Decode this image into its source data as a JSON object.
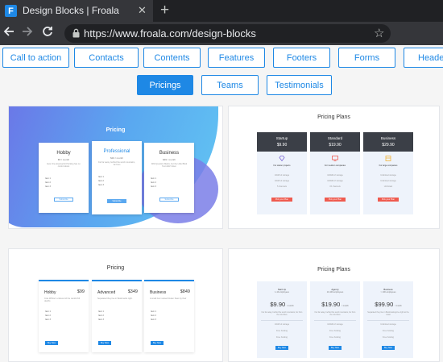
{
  "browser": {
    "tab_title": "Design Blocks | Froala",
    "favicon_letter": "F",
    "new_tab": "+",
    "close_tab": "✕",
    "url": "https://www.froala.com/design-blocks"
  },
  "categories": [
    "Call to action",
    "Contacts",
    "Contents",
    "Features",
    "Footers",
    "Forms",
    "Headers",
    "Pricings",
    "Teams",
    "Testimonials"
  ],
  "active_category": "Pricings",
  "cards": {
    "c1": {
      "title": "Pricing",
      "plans": [
        {
          "name": "Hobby",
          "price": "$5 / month",
          "desc": "Even the all-powerful Pointing has no control about",
          "items": [
            "Item 1",
            "Item 2",
            "Item 3"
          ],
          "button": "Subscribe"
        },
        {
          "name": "Professional",
          "price": "$19 / month",
          "desc": "Far far away, behind the word mountains, far from",
          "items": [
            "Item 1",
            "Item 2",
            "Item 3"
          ],
          "button": "Subscribe"
        },
        {
          "name": "Business",
          "price": "$49 / month",
          "desc": "Wild Question Marks, but the Little Blind Text didn't listen",
          "items": [
            "Item 1",
            "Item 2",
            "Item 3"
          ],
          "button": "Subscribe"
        }
      ]
    },
    "c2": {
      "title": "Pricing Plans",
      "plans": [
        {
          "name": "Startup",
          "price": "$9.90",
          "tag": "For starter projects",
          "lines": [
            "10GB of storage",
            "10GB of storage",
            "5 channels"
          ],
          "button": "Pick your Plan",
          "icon_color": "#7e6bd6"
        },
        {
          "name": "Standard",
          "price": "$19.90",
          "tag": "For medium companies",
          "lines": [
            "100GB of storage",
            "100GB of storage",
            "15 channels"
          ],
          "button": "Pick your Plan",
          "icon_color": "#ef5b4f"
        },
        {
          "name": "Business",
          "price": "$29.90",
          "tag": "For large companies",
          "lines": [
            "Unlimited storage",
            "Unlimited storage",
            "Unlimited"
          ],
          "button": "Pick your Plan",
          "icon_color": "#f2b43a"
        }
      ]
    },
    "c3": {
      "title": "Pricing",
      "plans": [
        {
          "name": "Hobby",
          "price": "$99",
          "desc": "Cras Whitre's unboxed of the candid hill depths",
          "items": [
            "Item 1",
            "Item 2",
            "Item 3"
          ],
          "button": "Buy Now"
        },
        {
          "name": "Advanced",
          "price": "$349",
          "desc": "Separated they live in Bookmarks right.",
          "items": [
            "Item 1",
            "Item 2",
            "Item 3"
          ],
          "button": "Buy Now"
        },
        {
          "name": "Business",
          "price": "$849",
          "desc": "A small river named Duden flows by their",
          "items": [
            "Item 1",
            "Item 2",
            "Item 3"
          ],
          "button": "Buy Now"
        }
      ]
    },
    "c4": {
      "title": "Pricing Plans",
      "plans": [
        {
          "name": "Start Up",
          "sub": "1-10 employees",
          "price": "$9.90",
          "period": "/ month",
          "desc": "Far far away, behind the word mountains, far from the countries",
          "lines": [
            "10GB of storage",
            "Free hosting",
            "Free hosting"
          ],
          "button": "Buy Now"
        },
        {
          "name": "Agency",
          "sub": "10-100 employees",
          "price": "$19.90",
          "period": "/ month",
          "desc": "Far far away, behind the word mountains, far from the countries",
          "lines": [
            "100GB of storage",
            "Free hosting",
            "Free hosting"
          ],
          "button": "Buy Now"
        },
        {
          "name": "Business",
          "sub": "> 100 employees",
          "price": "$99.90",
          "period": "/ month",
          "desc": "Separated they live in Bookmarksgrove right at the coast",
          "lines": [
            "Unlimited storage",
            "Free hosting",
            "Free hosting"
          ],
          "button": "Buy Now"
        }
      ]
    }
  },
  "colors": {
    "accent": "#1e88e5",
    "chrome_dark": "#202124",
    "chrome": "#35363a",
    "red": "#ef5b4f"
  }
}
